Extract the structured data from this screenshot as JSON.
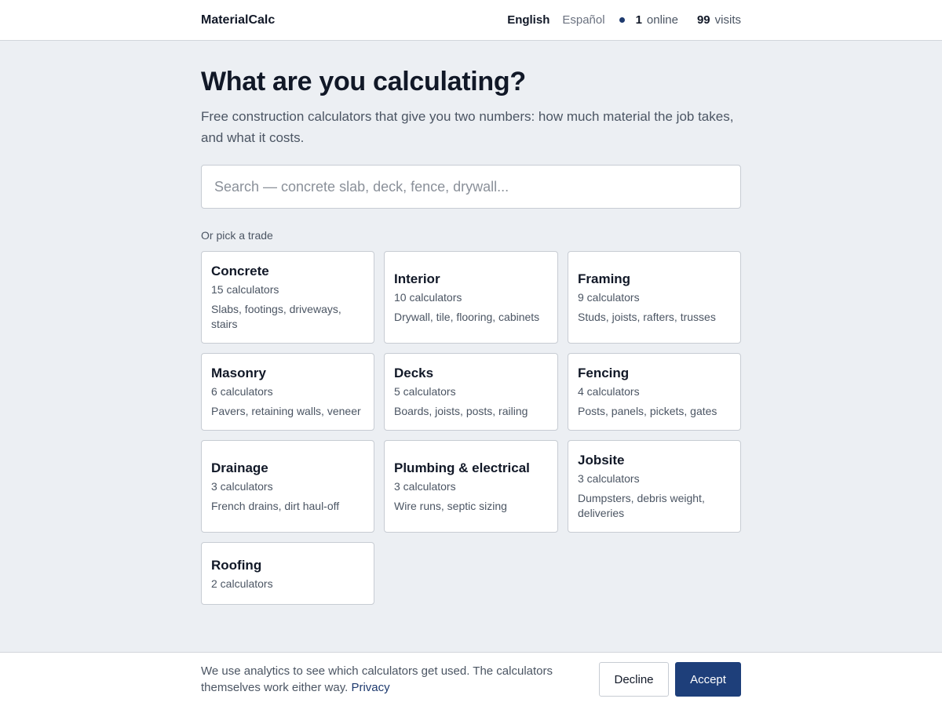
{
  "header": {
    "brand": "MaterialCalc",
    "languages": [
      "English",
      "Español"
    ],
    "online_count": "1",
    "online_label": "online",
    "visits_count": "99",
    "visits_label": "visits"
  },
  "main": {
    "title": "What are you calculating?",
    "subtitle": "Free construction calculators that give you two numbers: how much material the job takes, and what it costs.",
    "search_placeholder": "Search — concrete slab, deck, fence, drywall...",
    "section_label": "Or pick a trade",
    "trades": [
      {
        "name": "Concrete",
        "count": "15 calculators",
        "desc": "Slabs, footings, driveways, stairs"
      },
      {
        "name": "Interior",
        "count": "10 calculators",
        "desc": "Drywall, tile, flooring, cabinets"
      },
      {
        "name": "Framing",
        "count": "9 calculators",
        "desc": "Studs, joists, rafters, trusses"
      },
      {
        "name": "Masonry",
        "count": "6 calculators",
        "desc": "Pavers, retaining walls, veneer"
      },
      {
        "name": "Decks",
        "count": "5 calculators",
        "desc": "Boards, joists, posts, railing"
      },
      {
        "name": "Fencing",
        "count": "4 calculators",
        "desc": "Posts, panels, pickets, gates"
      },
      {
        "name": "Drainage",
        "count": "3 calculators",
        "desc": "French drains, dirt haul-off"
      },
      {
        "name": "Plumbing & electrical",
        "count": "3 calculators",
        "desc": "Wire runs, septic sizing"
      },
      {
        "name": "Jobsite",
        "count": "3 calculators",
        "desc": "Dumpsters, debris weight, deliveries"
      },
      {
        "name": "Roofing",
        "count": "2 calculators",
        "desc": ""
      }
    ]
  },
  "cookie": {
    "text": "We use analytics to see which calculators get used. The calculators themselves work either way.",
    "link": "Privacy",
    "decline": "Decline",
    "accept": "Accept"
  },
  "colors": {
    "background": "#eceff3",
    "accent": "#1e3f7a",
    "online_dot": "#1e3a6e"
  }
}
